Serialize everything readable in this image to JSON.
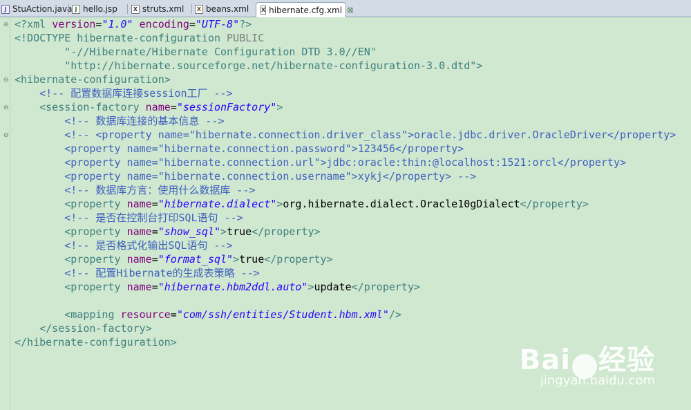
{
  "tabs": [
    {
      "label": "StuAction.java",
      "icon": "java-file-icon"
    },
    {
      "label": "hello.jsp",
      "icon": "jsp-file-icon"
    },
    {
      "label": "struts.xml",
      "icon": "xml-file-icon"
    },
    {
      "label": "beans.xml",
      "icon": "beans-xml-file-icon"
    },
    {
      "label": "hibernate.cfg.xml",
      "icon": "xml-file-icon",
      "active": true
    }
  ],
  "close_glyph": "⊠",
  "code": {
    "l1": {
      "open": "<?xml ",
      "a1": "version",
      "eq1": "=",
      "v1": "\"1.0\"",
      "a2": " encoding",
      "eq2": "=",
      "v2": "\"UTF-8\"",
      "close": "?>"
    },
    "l2": {
      "doctype": "<!DOCTYPE hibernate-configuration ",
      "public": "PUBLIC"
    },
    "l3": "        \"-//Hibernate/Hibernate Configuration DTD 3.0//EN\"",
    "l4": "        \"http://hibernate.sourceforge.net/hibernate-configuration-3.0.dtd\">",
    "l5": "<hibernate-configuration>",
    "l6": "    <!-- 配置数据库连接session工厂 -->",
    "l7": {
      "open": "    <session-factory ",
      "attr": "name",
      "eq": "=",
      "val": "\"sessionFactory\"",
      "close": ">"
    },
    "l8": "        <!-- 数据库连接的基本信息 -->",
    "l9": "        <!-- <property name=\"hibernate.connection.driver_class\">oracle.jdbc.driver.OracleDriver</property>",
    "l10": "        <property name=\"hibernate.connection.password\">123456</property>",
    "l11": "        <property name=\"hibernate.connection.url\">jdbc:oracle:thin:@localhost:1521:orcl</property>",
    "l12": "        <property name=\"hibernate.connection.username\">xykj</property> -->",
    "l13": "        <!-- 数据库方言：使用什么数据库 -->",
    "l14": {
      "open": "        <property ",
      "attr": "name",
      "eq": "=",
      "val": "\"hibernate.dialect\"",
      "gt": ">",
      "text": "org.hibernate.dialect.Oracle10gDialect",
      "close": "</property>"
    },
    "l15": "        <!-- 是否在控制台打印SQL语句 -->",
    "l16": {
      "open": "        <property ",
      "attr": "name",
      "eq": "=",
      "val": "\"show_sql\"",
      "gt": ">",
      "text": "true",
      "close": "</property>"
    },
    "l17": "        <!-- 是否格式化输出SQL语句 -->",
    "l18": {
      "open": "        <property ",
      "attr": "name",
      "eq": "=",
      "val": "\"format_sql\"",
      "gt": ">",
      "text": "true",
      "close": "</property>"
    },
    "l19": "        <!-- 配置Hibernate的生成表策略 -->",
    "l20": {
      "open": "        <property ",
      "attr": "name",
      "eq": "=",
      "val": "\"hibernate.hbm2ddl.auto\"",
      "gt": ">",
      "text": "update",
      "close": "</property>"
    },
    "l22": {
      "open": "        <mapping ",
      "attr": "resource",
      "eq": "=",
      "val": "\"com/ssh/entities/Student.hbm.xml\"",
      "close": "/>"
    },
    "l23": "    </session-factory>",
    "l24": "</hibernate-configuration>"
  },
  "watermark": {
    "logo_left": "Bai",
    "logo_right": "经验",
    "url": "jingyan.baidu.com"
  }
}
